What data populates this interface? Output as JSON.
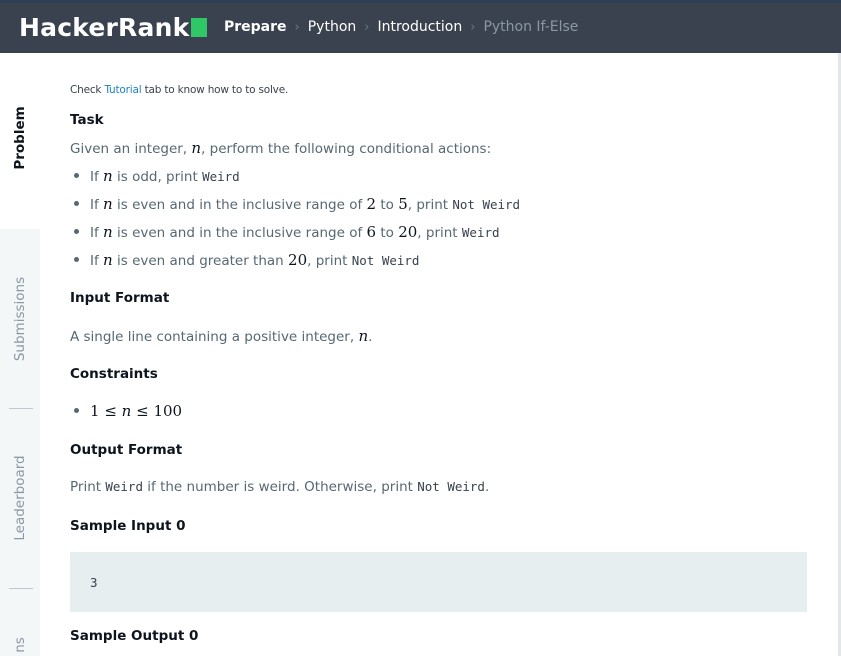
{
  "nav": {
    "logo": "HackerRank",
    "breadcrumbs": [
      "Prepare",
      "Python",
      "Introduction",
      "Python If-Else"
    ]
  },
  "sidebar": {
    "tabs": [
      "Problem",
      "Submissions",
      "Leaderboard",
      "Discussions"
    ],
    "visible_last_tab_fragment": "ns"
  },
  "hint": {
    "before": "Check ",
    "link": "Tutorial",
    "after": " tab to know how to to solve."
  },
  "task": {
    "heading": "Task",
    "intro_before": "Given an integer, ",
    "var": "n",
    "intro_after": ", perform the following conditional actions:",
    "rules": [
      {
        "pre": "If ",
        "v": "n",
        "mid": " is odd, print ",
        "out": "Weird"
      },
      {
        "pre": "If ",
        "v": "n",
        "mid": " is even and in the inclusive range of ",
        "a": "2",
        "to": " to ",
        "b": "5",
        "post": ", print ",
        "out": "Not Weird"
      },
      {
        "pre": "If ",
        "v": "n",
        "mid": " is even and in the inclusive range of ",
        "a": "6",
        "to": " to ",
        "b": "20",
        "post": ", print ",
        "out": "Weird"
      },
      {
        "pre": "If ",
        "v": "n",
        "mid": " is even and greater than ",
        "a": "20",
        "post": ", print ",
        "out": "Not Weird"
      }
    ]
  },
  "input_format": {
    "heading": "Input Format",
    "text_before": "A single line containing a positive integer, ",
    "var": "n",
    "text_after": "."
  },
  "constraints": {
    "heading": "Constraints",
    "lo": "1",
    "le1": " ≤ ",
    "var": "n",
    "le2": " ≤ ",
    "hi": "100"
  },
  "output_format": {
    "heading": "Output Format",
    "t1": "Print ",
    "c1": "Weird",
    "t2": " if the number is weird. Otherwise, print ",
    "c2": "Not Weird",
    "t3": "."
  },
  "sample_input": {
    "heading": "Sample Input 0",
    "value": "3"
  },
  "sample_output": {
    "heading": "Sample Output 0"
  },
  "colors": {
    "nav_bg": "#39424e",
    "brand_green": "#2ec866",
    "link": "#1c84c6",
    "code_bg": "#e6eef0"
  }
}
